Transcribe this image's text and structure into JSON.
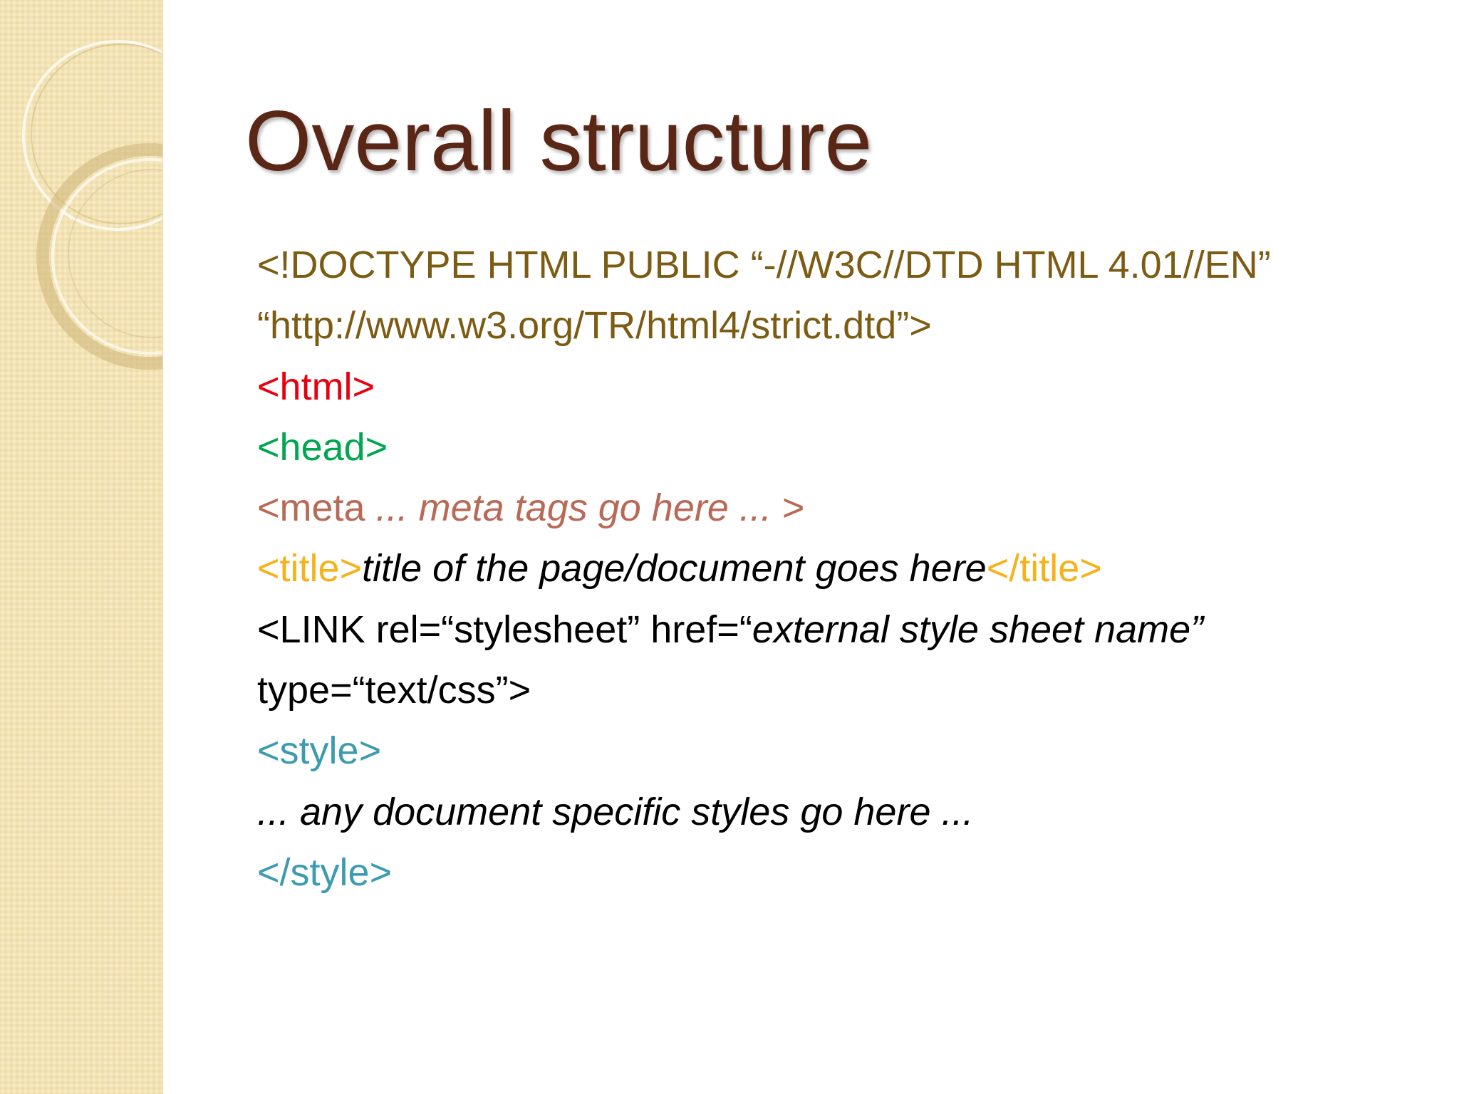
{
  "slide": {
    "title": "Overall structure",
    "lines": [
      {
        "text": "<!DOCTYPE HTML PUBLIC “-//W3C//DTD HTML 4.01//EN”"
      },
      {
        "text": "“http://www.w3.org/TR/html4/strict.dtd”>"
      },
      {
        "text": "<html>"
      },
      {
        "text": "<head>"
      },
      {
        "tag": "<meta",
        "italic": " ... meta tags go here ... ",
        "end": ">"
      },
      {
        "open": "<title>",
        "italic": "title of the page/document goes here",
        "close": "</title>"
      },
      {
        "plain": "<LINK rel=“stylesheet” href=“",
        "italic": "external style sheet name”"
      },
      {
        "text": "type=“text/css”>"
      },
      {
        "text": "<style>"
      },
      {
        "text": "... any document specific styles go here ..."
      },
      {
        "text": "</style>"
      }
    ]
  },
  "colors": {
    "title": "#5a2616",
    "doctype": "#7c5b12",
    "html_tag": "#e8000f",
    "head_tag": "#00a650",
    "meta_tag": "#b86a56",
    "title_tag": "#f5b21b",
    "body_text": "#000000",
    "style_tag": "#3d9bb0",
    "side_panel": "#f3e3b4"
  }
}
